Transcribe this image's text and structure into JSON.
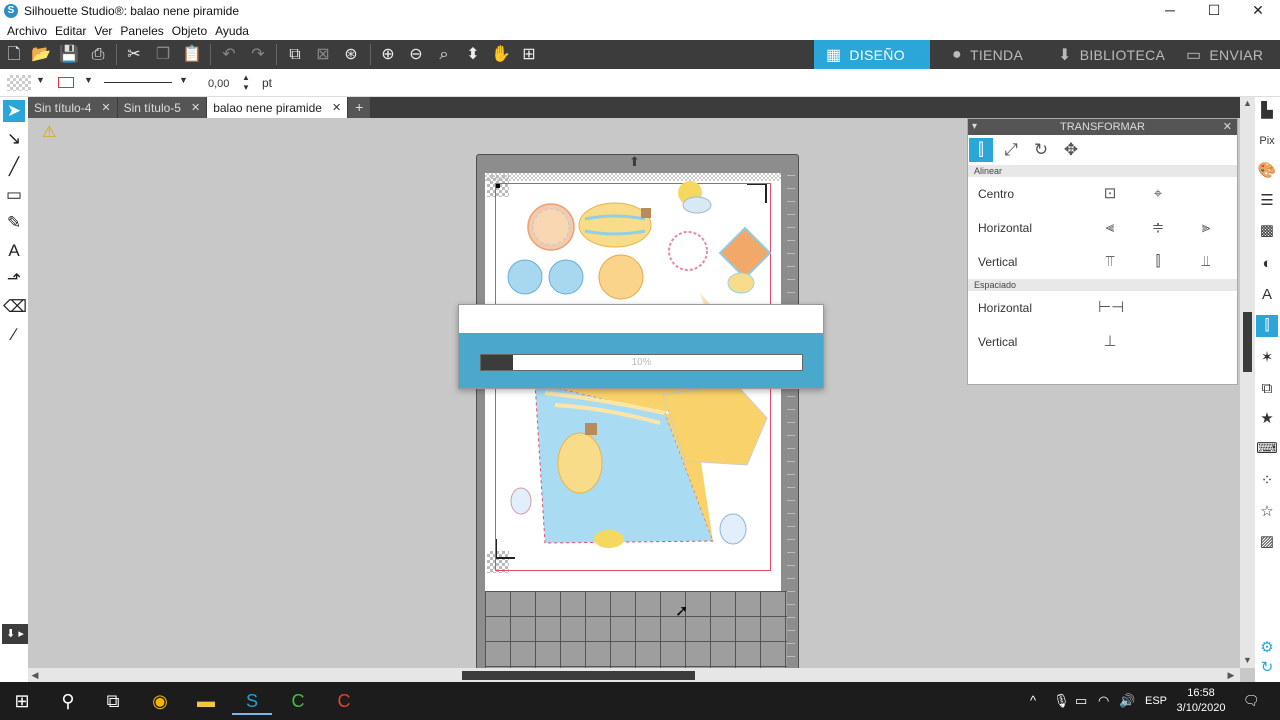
{
  "window": {
    "title": "Silhouette Studio®: balao nene piramide",
    "minimize": "─",
    "maximize": "☐",
    "close": "✕"
  },
  "menu": [
    "Archivo",
    "Editar",
    "Ver",
    "Paneles",
    "Objeto",
    "Ayuda"
  ],
  "nav_tabs": [
    {
      "label": "DISEÑO",
      "icon": "grid-icon",
      "active": true
    },
    {
      "label": "TIENDA",
      "icon": "store-icon",
      "active": false
    },
    {
      "label": "BIBLIOTECA",
      "icon": "library-icon",
      "active": false
    },
    {
      "label": "ENVIAR",
      "icon": "send-icon",
      "active": false
    }
  ],
  "line_toolbar": {
    "line_width": "0,00",
    "unit": "pt"
  },
  "doc_tabs": [
    {
      "label": "Sin título-4",
      "close": "✕",
      "active": false
    },
    {
      "label": "Sin título-5",
      "close": "✕",
      "active": false
    },
    {
      "label": "balao nene piramide",
      "close": "✕",
      "active": true
    }
  ],
  "add_tab": "+",
  "progress": {
    "percent_text": "10%",
    "value": 0.1
  },
  "transform_panel": {
    "title": "TRANSFORMAR",
    "close": "✕",
    "section_align": "Alinear",
    "row_center": "Centro",
    "row_horizontal": "Horizontal",
    "row_vertical": "Vertical",
    "section_spacing": "Espaciado",
    "row_space_horizontal": "Horizontal",
    "row_space_vertical": "Vertical"
  },
  "taskbar": {
    "language": "ESP",
    "time": "16:58",
    "date": "3/10/2020"
  },
  "colors": {
    "accent": "#2aa6d9",
    "toolbar": "#3c3c3c",
    "dialog": "#4aa8cc",
    "cut_line": "#e04b6a"
  }
}
